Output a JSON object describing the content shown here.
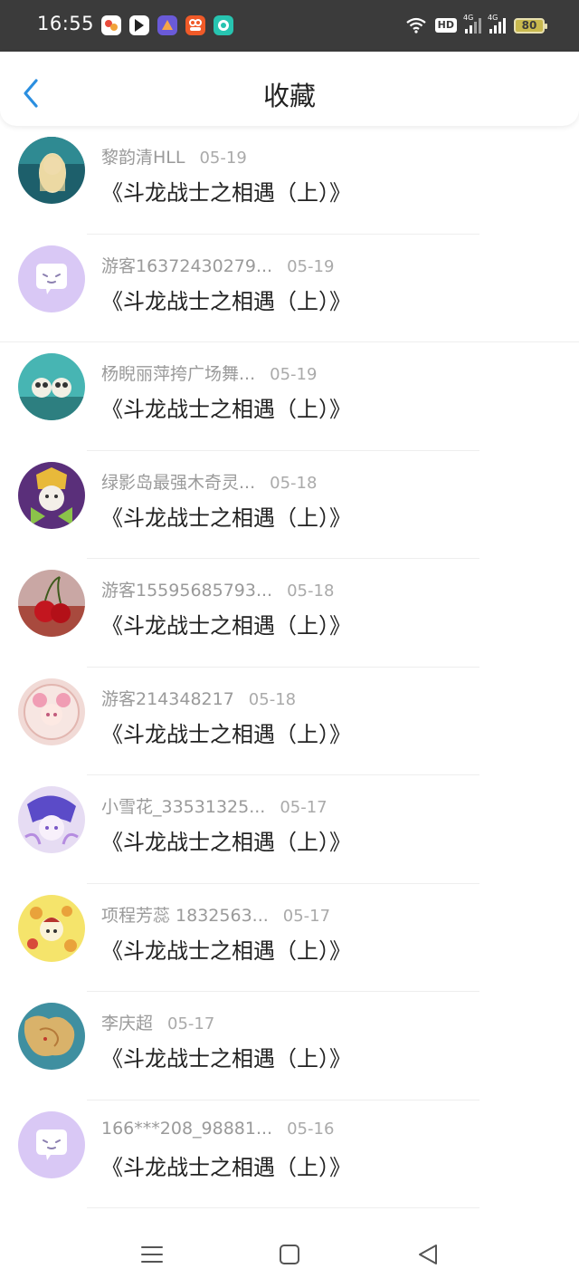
{
  "status_bar": {
    "time": "16:55",
    "hd_label": "HD",
    "network_label": "4G",
    "battery_level": "80"
  },
  "header": {
    "title": "收藏",
    "back_icon": "chevron-left-icon"
  },
  "favorites": [
    {
      "name": "黎韵清HLL",
      "date": "05-19",
      "book": "《斗龙战士之相遇（上）》"
    },
    {
      "name": "游客16372430279...",
      "date": "05-19",
      "book": "《斗龙战士之相遇（上）》"
    },
    {
      "name": "杨睨丽萍挎广场舞...",
      "date": "05-19",
      "book": "《斗龙战士之相遇（上）》"
    },
    {
      "name": "绿影岛最强木奇灵...",
      "date": "05-18",
      "book": "《斗龙战士之相遇（上）》"
    },
    {
      "name": "游客15595685793...",
      "date": "05-18",
      "book": "《斗龙战士之相遇（上）》"
    },
    {
      "name": "游客214348217",
      "date": "05-18",
      "book": "《斗龙战士之相遇（上）》"
    },
    {
      "name": "小雪花_33531325...",
      "date": "05-17",
      "book": "《斗龙战士之相遇（上）》"
    },
    {
      "name": "项程芳蕊 1832563...",
      "date": "05-17",
      "book": "《斗龙战士之相遇（上）》"
    },
    {
      "name": "李庆超",
      "date": "05-17",
      "book": "《斗龙战士之相遇（上）》"
    },
    {
      "name": "166***208_98881...",
      "date": "05-16",
      "book": "《斗龙战士之相遇（上）》"
    }
  ],
  "nav_bar": [
    "menu-icon",
    "home-square-icon",
    "back-triangle-icon"
  ],
  "colors": {
    "status_bar_bg": "#3b3b3b",
    "accent": "#2b8fe0",
    "default_avatar_bg": "#d9c8f5",
    "name_text": "#9a9a9a",
    "title_text": "#222222"
  }
}
